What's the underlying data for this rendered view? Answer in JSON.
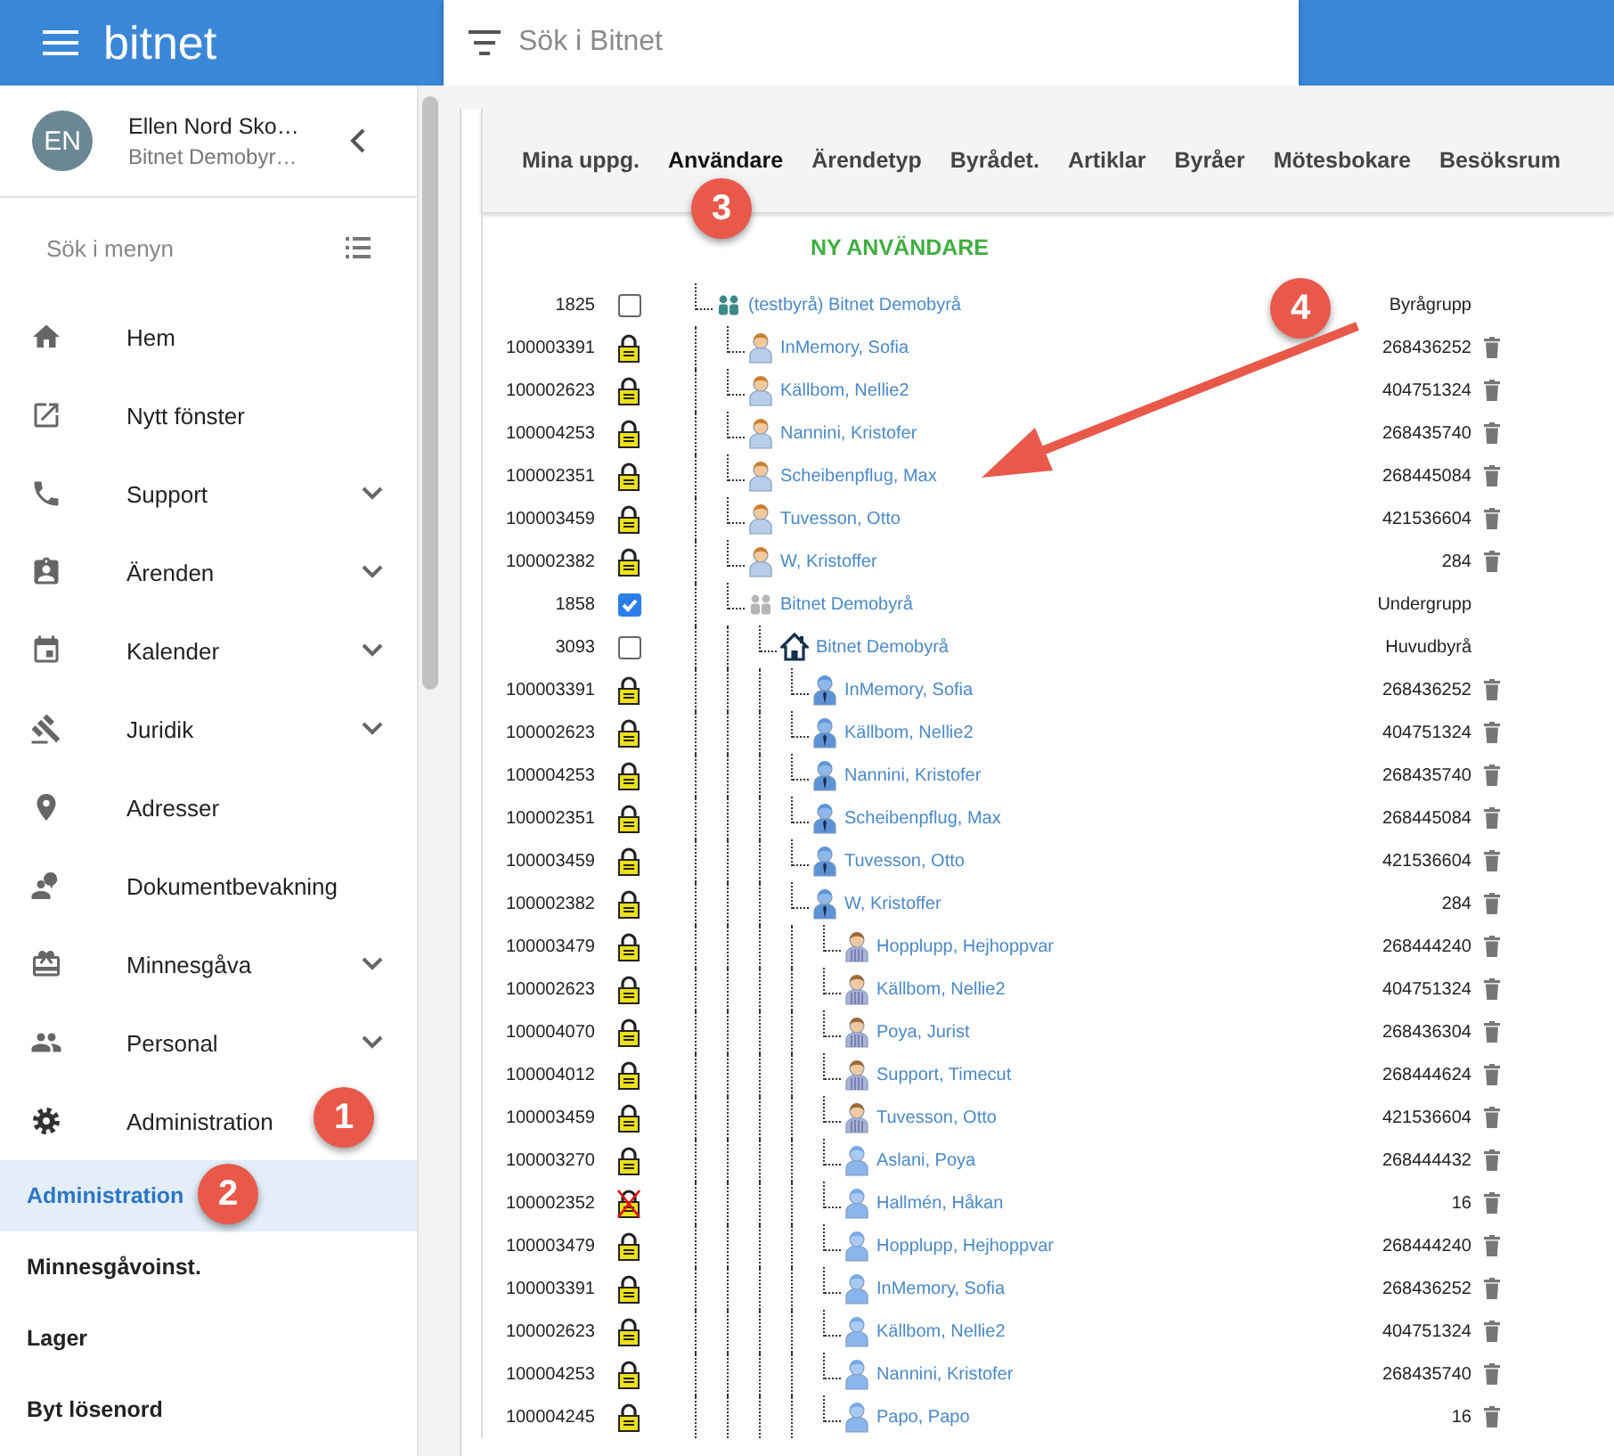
{
  "header": {
    "app_name": "bitnet",
    "search": {
      "placeholder": "Sök i Bitnet"
    }
  },
  "sidebar": {
    "user": {
      "initials": "EN",
      "name": "Ellen Nord Sko…",
      "office": "Bitnet Demobyr…"
    },
    "menu_search": {
      "placeholder": "Sök i menyn"
    },
    "items": [
      {
        "label": "Hem",
        "expandable": false
      },
      {
        "label": "Nytt fönster",
        "expandable": false
      },
      {
        "label": "Support",
        "expandable": true
      },
      {
        "label": "Ärenden",
        "expandable": true
      },
      {
        "label": "Kalender",
        "expandable": true
      },
      {
        "label": "Juridik",
        "expandable": true
      },
      {
        "label": "Adresser",
        "expandable": false
      },
      {
        "label": "Dokumentbevakning",
        "expandable": false
      },
      {
        "label": "Minnesgåva",
        "expandable": true
      },
      {
        "label": "Personal",
        "expandable": true
      },
      {
        "label": "Administration",
        "expandable": false
      }
    ],
    "sub_items": [
      {
        "label": "Administration",
        "selected": true
      },
      {
        "label": "Minnesgåvoinst.",
        "selected": false
      },
      {
        "label": "Lager",
        "selected": false
      },
      {
        "label": "Byt lösenord",
        "selected": false
      }
    ]
  },
  "tabs": [
    {
      "label": "Mina uppg.",
      "selected": false
    },
    {
      "label": "Användare",
      "selected": true
    },
    {
      "label": "Ärendetyp",
      "selected": false
    },
    {
      "label": "Byrådet.",
      "selected": false
    },
    {
      "label": "Artiklar",
      "selected": false
    },
    {
      "label": "Byråer",
      "selected": false
    },
    {
      "label": "Mötesbokare",
      "selected": false
    },
    {
      "label": "Besöksrum",
      "selected": false
    }
  ],
  "new_user_link": "NY ANVÄNDARE",
  "tree": [
    {
      "id": "1825",
      "control": {
        "kind": "checkbox",
        "checked": false
      },
      "kind": "group",
      "name": "(testbyrå) Bitnet Demobyrå",
      "value": "Byrågrupp",
      "trash": false,
      "children": [
        {
          "id": "100003391",
          "control": {
            "kind": "lock",
            "blocked": false
          },
          "kind": "user-orange",
          "name": "InMemory, Sofia",
          "value": "268436252",
          "trash": true
        },
        {
          "id": "100002623",
          "control": {
            "kind": "lock",
            "blocked": false
          },
          "kind": "user-orange",
          "name": "Källbom, Nellie2",
          "value": "404751324",
          "trash": true
        },
        {
          "id": "100004253",
          "control": {
            "kind": "lock",
            "blocked": false
          },
          "kind": "user-orange",
          "name": "Nannini, Kristofer",
          "value": "268435740",
          "trash": true
        },
        {
          "id": "100002351",
          "control": {
            "kind": "lock",
            "blocked": false
          },
          "kind": "user-orange",
          "name": "Scheibenpflug, Max",
          "value": "268445084",
          "trash": true
        },
        {
          "id": "100003459",
          "control": {
            "kind": "lock",
            "blocked": false
          },
          "kind": "user-orange",
          "name": "Tuvesson, Otto",
          "value": "421536604",
          "trash": true
        },
        {
          "id": "100002382",
          "control": {
            "kind": "lock",
            "blocked": false
          },
          "kind": "user-orange",
          "name": "W, Kristoffer",
          "value": "284",
          "trash": true
        },
        {
          "id": "1858",
          "control": {
            "kind": "checkbox",
            "checked": true
          },
          "kind": "group-muted",
          "name": "Bitnet Demobyrå",
          "value": "Undergrupp",
          "trash": false,
          "children": [
            {
              "id": "3093",
              "control": {
                "kind": "checkbox",
                "checked": false
              },
              "kind": "office",
              "name": "Bitnet Demobyrå",
              "value": "Huvudbyrå",
              "trash": false,
              "children": [
                {
                  "id": "100003391",
                  "control": {
                    "kind": "lock",
                    "blocked": false
                  },
                  "kind": "user-tie",
                  "name": "InMemory, Sofia",
                  "value": "268436252",
                  "trash": true
                },
                {
                  "id": "100002623",
                  "control": {
                    "kind": "lock",
                    "blocked": false
                  },
                  "kind": "user-tie",
                  "name": "Källbom, Nellie2",
                  "value": "404751324",
                  "trash": true
                },
                {
                  "id": "100004253",
                  "control": {
                    "kind": "lock",
                    "blocked": false
                  },
                  "kind": "user-tie",
                  "name": "Nannini, Kristofer",
                  "value": "268435740",
                  "trash": true
                },
                {
                  "id": "100002351",
                  "control": {
                    "kind": "lock",
                    "blocked": false
                  },
                  "kind": "user-tie",
                  "name": "Scheibenpflug, Max",
                  "value": "268445084",
                  "trash": true
                },
                {
                  "id": "100003459",
                  "control": {
                    "kind": "lock",
                    "blocked": false
                  },
                  "kind": "user-tie",
                  "name": "Tuvesson, Otto",
                  "value": "421536604",
                  "trash": true
                },
                {
                  "id": "100002382",
                  "control": {
                    "kind": "lock",
                    "blocked": false
                  },
                  "kind": "user-tie",
                  "name": "W, Kristoffer",
                  "value": "284",
                  "trash": true,
                  "children": [
                    {
                      "id": "100003479",
                      "control": {
                        "kind": "lock",
                        "blocked": false
                      },
                      "kind": "user-striped",
                      "name": "Hopplupp, Hejhoppvar",
                      "value": "268444240",
                      "trash": true
                    },
                    {
                      "id": "100002623",
                      "control": {
                        "kind": "lock",
                        "blocked": false
                      },
                      "kind": "user-striped",
                      "name": "Källbom, Nellie2",
                      "value": "404751324",
                      "trash": true
                    },
                    {
                      "id": "100004070",
                      "control": {
                        "kind": "lock",
                        "blocked": false
                      },
                      "kind": "user-striped",
                      "name": "Poya, Jurist",
                      "value": "268436304",
                      "trash": true
                    },
                    {
                      "id": "100004012",
                      "control": {
                        "kind": "lock",
                        "blocked": false
                      },
                      "kind": "user-striped",
                      "name": "Support, Timecut",
                      "value": "268444624",
                      "trash": true
                    },
                    {
                      "id": "100003459",
                      "control": {
                        "kind": "lock",
                        "blocked": false
                      },
                      "kind": "user-striped",
                      "name": "Tuvesson, Otto",
                      "value": "421536604",
                      "trash": true
                    },
                    {
                      "id": "100003270",
                      "control": {
                        "kind": "lock",
                        "blocked": false
                      },
                      "kind": "user-blue",
                      "name": "Aslani, Poya",
                      "value": "268444432",
                      "trash": true
                    },
                    {
                      "id": "100002352",
                      "control": {
                        "kind": "lock",
                        "blocked": true
                      },
                      "kind": "user-blue",
                      "name": "Hallmén, Håkan",
                      "value": "16",
                      "trash": true
                    },
                    {
                      "id": "100003479",
                      "control": {
                        "kind": "lock",
                        "blocked": false
                      },
                      "kind": "user-blue",
                      "name": "Hopplupp, Hejhoppvar",
                      "value": "268444240",
                      "trash": true
                    },
                    {
                      "id": "100003391",
                      "control": {
                        "kind": "lock",
                        "blocked": false
                      },
                      "kind": "user-blue",
                      "name": "InMemory, Sofia",
                      "value": "268436252",
                      "trash": true
                    },
                    {
                      "id": "100002623",
                      "control": {
                        "kind": "lock",
                        "blocked": false
                      },
                      "kind": "user-blue",
                      "name": "Källbom, Nellie2",
                      "value": "404751324",
                      "trash": true
                    },
                    {
                      "id": "100004253",
                      "control": {
                        "kind": "lock",
                        "blocked": false
                      },
                      "kind": "user-blue",
                      "name": "Nannini, Kristofer",
                      "value": "268435740",
                      "trash": true
                    },
                    {
                      "id": "100004245",
                      "control": {
                        "kind": "lock",
                        "blocked": false
                      },
                      "kind": "user-blue",
                      "name": "Papo, Papo",
                      "value": "16",
                      "trash": true
                    }
                  ]
                }
              ]
            }
          ]
        }
      ]
    }
  ],
  "callouts": [
    {
      "label": "1"
    },
    {
      "label": "2"
    },
    {
      "label": "3"
    },
    {
      "label": "4"
    }
  ]
}
